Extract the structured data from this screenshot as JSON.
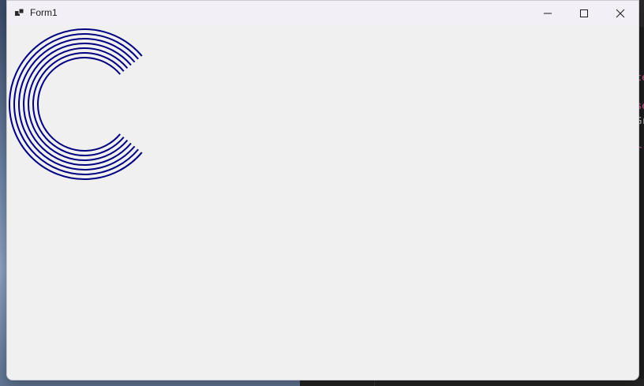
{
  "window": {
    "title": "Form1",
    "icons": {
      "app": "app-icon",
      "minimize": "minimize-icon",
      "maximize": "maximize-icon",
      "close": "close-icon"
    }
  },
  "drawing": {
    "shape": "concentric-open-arcs",
    "arc_count": 7,
    "opening": "right",
    "color": "#000080"
  },
  "background": {
    "code_fragments": [
      {
        "text": "te",
        "color": "#e0669a"
      },
      {
        "text": "se",
        "color": "#e0669a"
      },
      {
        "text": "Gr",
        "color": "#d4d4d4"
      },
      {
        "text": "r",
        "color": "#e0669a"
      }
    ]
  }
}
